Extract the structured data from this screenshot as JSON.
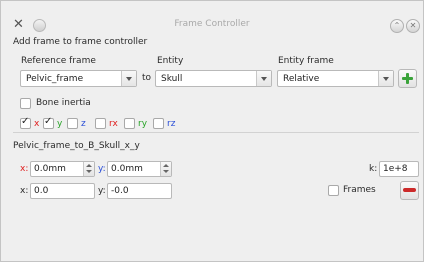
{
  "window": {
    "title": "Frame Controller"
  },
  "header": "Add frame to frame controller",
  "columns": {
    "reference_frame": "Reference frame",
    "entity": "Entity",
    "entity_frame": "Entity frame"
  },
  "reference_frame": {
    "value": "Pelvic_frame"
  },
  "to_label": "to",
  "entity": {
    "value": "Skull"
  },
  "entity_frame": {
    "value": "Relative"
  },
  "bone_inertia": {
    "label": "Bone inertia",
    "checked": false
  },
  "axes": [
    {
      "label": "x",
      "checked": true,
      "color": "#e02020"
    },
    {
      "label": "y",
      "checked": true,
      "color": "#28a428"
    },
    {
      "label": "z",
      "checked": false,
      "color": "#2b4fd8"
    },
    {
      "label": "rx",
      "checked": false,
      "color": "#e02020"
    },
    {
      "label": "ry",
      "checked": false,
      "color": "#28a428"
    },
    {
      "label": "rz",
      "checked": false,
      "color": "#2b4fd8"
    }
  ],
  "controller": {
    "name": "Pelvic_frame_to_B_Skull_x_y",
    "x_target_label": "x:",
    "x_target": "0.0mm",
    "y_target_label": "y:",
    "y_target": "0.0mm",
    "k_label": "k:",
    "k_value": "1e+8",
    "x_current_label": "x:",
    "x_current": "0.0",
    "y_current_label": "y:",
    "y_current": "-0.0",
    "frames_label": "Frames",
    "frames_checked": false
  },
  "colors": {
    "red_label": "#e02020",
    "blue_label": "#2b4fd8",
    "add_green": "#3aa33a",
    "remove_red": "#cc2a2a"
  }
}
